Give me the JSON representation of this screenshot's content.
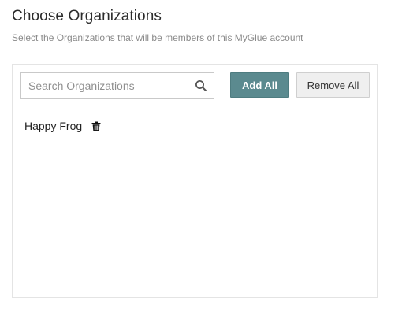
{
  "header": {
    "title": "Choose Organizations",
    "subtitle": "Select the Organizations that will be members of this MyGlue account"
  },
  "search": {
    "placeholder": "Search Organizations",
    "value": ""
  },
  "actions": {
    "add_all_label": "Add All",
    "remove_all_label": "Remove All"
  },
  "organizations": [
    {
      "name": "Happy Frog"
    }
  ],
  "colors": {
    "add_button_bg": "#5b8a8f",
    "remove_button_bg": "#efefef"
  },
  "icons": {
    "search": "search-icon",
    "delete": "trash-icon"
  }
}
